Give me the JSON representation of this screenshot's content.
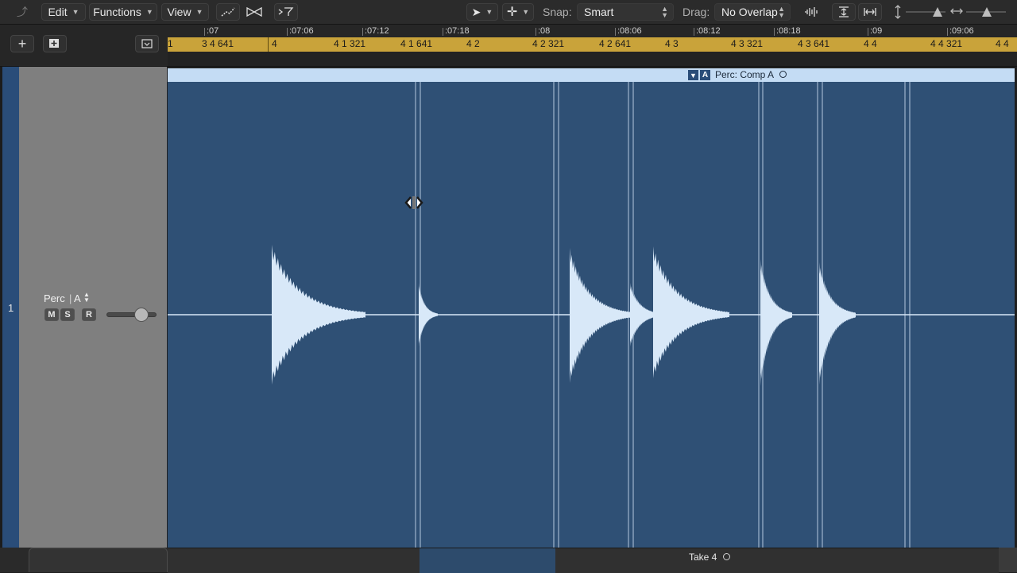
{
  "toolbar": {
    "edit_label": "Edit",
    "functions_label": "Functions",
    "view_label": "View",
    "snap_label": "Snap:",
    "snap_value": "Smart",
    "drag_label": "Drag:",
    "drag_value": "No Overlap"
  },
  "ruler": {
    "time_labels": [
      ":07",
      ":07:06",
      ":07:12",
      ":07:18",
      ":08",
      ":08:06",
      ":08:12",
      ":08:18",
      ":09",
      ":09:06"
    ],
    "bar_labels": [
      "1",
      "3 4 641",
      "4",
      "4 1 321",
      "4 1 641",
      "4 2",
      "4 2 321",
      "4 2 641",
      "4 3",
      "4 3 321",
      "4 3 641",
      "4 4",
      "4 4 321",
      "4 4"
    ]
  },
  "track": {
    "number": "1",
    "name": "Perc",
    "take": "A",
    "mute_label": "M",
    "solo_label": "S",
    "record_label": "R",
    "volume_level": 0.82
  },
  "region": {
    "name": "Perc: Comp A",
    "badge_a": "A",
    "fill_color": "#2f5075",
    "header_color": "#c4dcf4"
  },
  "take_lane": {
    "label": "Take 4"
  },
  "colors": {
    "ruler_bar": "#c9a33a",
    "track_color": "#2a4d79",
    "waveform": "#d8e8f8"
  }
}
